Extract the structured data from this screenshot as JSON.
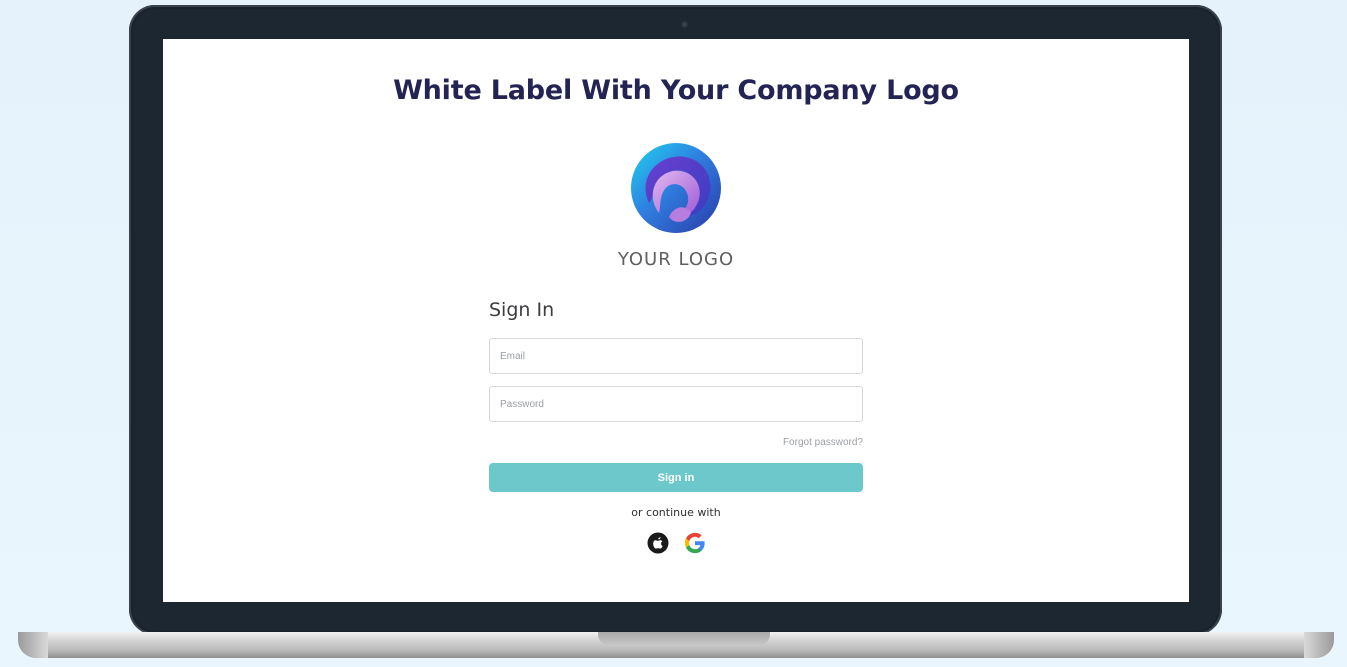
{
  "screen": {
    "headline": "White Label With Your Company Logo",
    "logo_text": "YOUR LOGO",
    "sign_in_title": "Sign In",
    "email_placeholder": "Email",
    "password_placeholder": "Password",
    "forgot_password": "Forgot password?",
    "sign_in_button": "Sign in",
    "continue_with": "or continue with",
    "social_icons": [
      "apple-icon",
      "google-icon"
    ]
  },
  "colors": {
    "headline": "#232454",
    "button": "#6cc8cb",
    "bezel": "#1d2731",
    "background": "#e6f2fb"
  }
}
